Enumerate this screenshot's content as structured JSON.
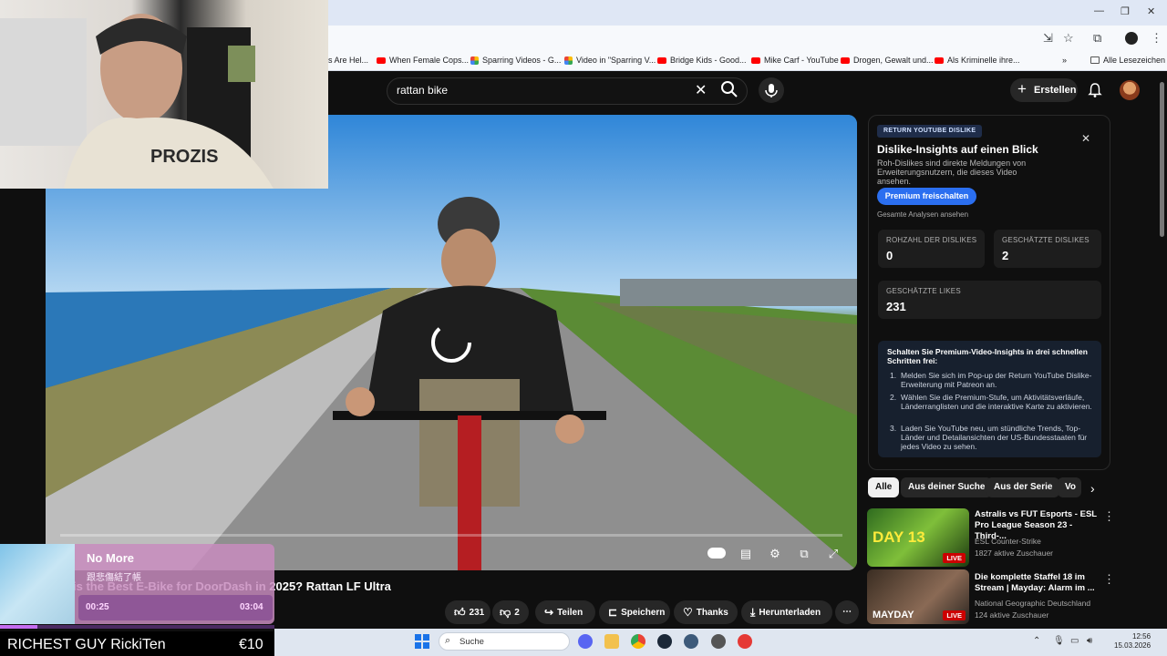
{
  "browser": {
    "bookmarks": [
      {
        "label": "s Are Hel...",
        "icon": "none"
      },
      {
        "label": "When Female Cops...",
        "icon": "youtube"
      },
      {
        "label": "Sparring Videos - G...",
        "icon": "drive"
      },
      {
        "label": "Video in \"Sparring V...",
        "icon": "drive"
      },
      {
        "label": "Bridge Kids - Good...",
        "icon": "youtube"
      },
      {
        "label": "Mike Carf - YouTube",
        "icon": "youtube"
      },
      {
        "label": "Drogen, Gewalt und...",
        "icon": "youtube"
      },
      {
        "label": "Als Kriminelle ihre...",
        "icon": "youtube"
      }
    ],
    "all_bookmarks": "Alle Lesezeichen"
  },
  "youtube": {
    "search_query": "rattan bike",
    "create_label": "Erstellen"
  },
  "video": {
    "title": "is the Best E-Bike for DoorDash in 2025? Rattan LF Ultra",
    "likes": "231",
    "dislikes": "2",
    "actions": {
      "share": "Teilen",
      "save": "Speichern",
      "thanks": "Thanks",
      "download": "Herunterladen"
    }
  },
  "music_widget": {
    "title": "No More",
    "subtitle": "跟悲傷結了帳",
    "current_time": "00:25",
    "total_time": "03:04",
    "progress": 0.136
  },
  "caption": {
    "name": "RICHEST GUY RickiTen",
    "amount": "€10"
  },
  "dislike_panel": {
    "badge": "RETURN YOUTUBE DISLIKE",
    "title": "Dislike-Insights auf einen Blick",
    "description": "Roh-Dislikes sind direkte Meldungen von Erweiterungsnutzern, die dieses Video ansehen.",
    "premium_button": "Premium freischalten",
    "all_analytics": "Gesamte Analysen ansehen",
    "stats": [
      {
        "label": "ROHZAHL DER DISLIKES",
        "value": "0"
      },
      {
        "label": "GESCHÄTZTE DISLIKES",
        "value": "2"
      },
      {
        "label": "GESCHÄTZTE LIKES",
        "value": "231"
      }
    ],
    "steps_heading": "Schalten Sie Premium-Video-Insights in drei schnellen Schritten frei:",
    "steps": [
      "Melden Sie sich im Pop-up der Return YouTube Dislike-Erweiterung mit Patreon an.",
      "Wählen Sie die Premium-Stufe, um Aktivitätsverläufe, Länderranglisten und die interaktive Karte zu aktivieren.",
      "Laden Sie YouTube neu, um stündliche Trends, Top-Länder und Detailansichten der US-Bundesstaaten für jedes Video zu sehen."
    ]
  },
  "chips": [
    "Alle",
    "Aus deiner Suche",
    "Aus der Serie",
    "Vo"
  ],
  "recommendations": [
    {
      "title": "Astralis vs FUT Esports - ESL Pro League Season 23 - Third-...",
      "channel": "ESL Counter-Strike",
      "meta": "1827 aktive Zuschauer",
      "badge": "LIVE",
      "thumb_text": "DAY 13"
    },
    {
      "title": "Die komplette Staffel 18 im Stream | Mayday: Alarm im ...",
      "channel": "National Geographic Deutschland",
      "meta": "124 aktive Zuschauer",
      "badge": "LIVE",
      "thumb_text": "MAYDAY"
    }
  ],
  "taskbar": {
    "search_label": "Suche",
    "time": "12:56",
    "date": "15.03.2026"
  }
}
